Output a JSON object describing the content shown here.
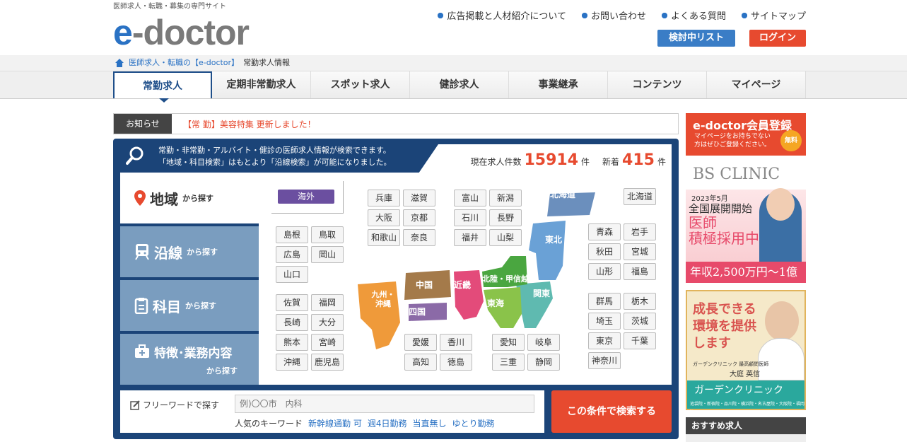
{
  "header": {
    "tagline": "医師求人・転職・募集の専門サイト",
    "logo_e": "e",
    "logo_rest": "-doctor",
    "links": [
      "広告掲載と人材紹介について",
      "お問い合わせ",
      "よくある質問",
      "サイトマップ"
    ],
    "list_button": "検討中リスト",
    "login_button": "ログイン"
  },
  "breadcrumb": {
    "home": "医師求人・転職の【e-doctor】",
    "current": "常勤求人情報"
  },
  "nav": {
    "tabs": [
      "常勤求人",
      "定期非常勤求人",
      "スポット求人",
      "健診求人",
      "事業継承",
      "コンテンツ",
      "マイページ"
    ]
  },
  "news": {
    "label": "お知らせ",
    "text": "【常 勤】美容特集 更新しました！"
  },
  "search": {
    "intro1": "常勤・非常勤・アルバイト・健診の医師求人情報が検索できます。",
    "intro2": "「地域・科目検索」はもとより「沿線検索」が可能になりました。",
    "count_label": "現在求人件数",
    "count_value": "15914",
    "count_unit": "件",
    "new_label": "新着",
    "new_value": "415",
    "new_unit": "件",
    "side": [
      {
        "big": "地域",
        "small": "から探す"
      },
      {
        "big": "沿線",
        "small": "から探す"
      },
      {
        "big": "科目",
        "small": "から探す"
      },
      {
        "big": "特徴･業務内容",
        "small": "から探す"
      }
    ],
    "kaigai": "海外",
    "regions": [
      "北海道",
      "東北",
      "関東",
      "北陸・甲信越",
      "東海",
      "近畿",
      "中国",
      "四国",
      "九州・沖縄"
    ],
    "prefs": {
      "hokkaido": [
        "北海道"
      ],
      "tohoku": [
        "青森",
        "岩手",
        "秋田",
        "宮城",
        "山形",
        "福島"
      ],
      "kanto": [
        "群馬",
        "栃木",
        "埼玉",
        "茨城",
        "東京",
        "千葉",
        "神奈川"
      ],
      "kinki": [
        "兵庫",
        "滋賀",
        "大阪",
        "京都",
        "和歌山",
        "奈良"
      ],
      "hokuriku": [
        "富山",
        "新潟",
        "石川",
        "長野",
        "福井",
        "山梨"
      ],
      "chugoku": [
        "島根",
        "鳥取",
        "広島",
        "岡山",
        "山口"
      ],
      "kyushu": [
        "佐賀",
        "福岡",
        "長崎",
        "大分",
        "熊本",
        "宮崎",
        "沖縄",
        "鹿児島"
      ],
      "shikoku": [
        "愛媛",
        "香川",
        "高知",
        "徳島"
      ],
      "tokai": [
        "愛知",
        "岐阜",
        "三重",
        "静岡"
      ]
    },
    "freeword_label": "フリーワードで探す",
    "freeword_placeholder": "例)〇〇市　内科",
    "keywords_label": "人気のキーワード",
    "keywords": [
      "新幹線通勤 可",
      "週4日勤務",
      "当直無し",
      "ゆとり勤務"
    ],
    "submit": "この条件で検索する"
  },
  "sidebar": {
    "member_title": "e-doctor会員登録",
    "member_sub1": "マイページをお持ちでない",
    "member_sub2": "方はぜひご登録ください。",
    "member_badge": "無料",
    "bs_logo": "BS CLINIC",
    "bs_date": "2023年5月",
    "bs_line1": "全国展開開始",
    "bs_line2": "医師",
    "bs_line3": "積極採用中",
    "bs_salary": "年収2,500万円〜1億円",
    "garden_text": "成長できる環境を提供します",
    "garden_sub": "ガーデンクリニック 最高顧問医師",
    "garden_name": "大庭 英信",
    "garden_brand": "ガーデンクリニック",
    "garden_addr": "池袋院・新宿院・品川院・横浜院・名古屋院・大阪院・福岡院",
    "recommend": "おすすめ求人"
  },
  "colors": {
    "brand_blue": "#2a72c4",
    "navy": "#1b4478",
    "accent_red": "#e74a2f"
  }
}
